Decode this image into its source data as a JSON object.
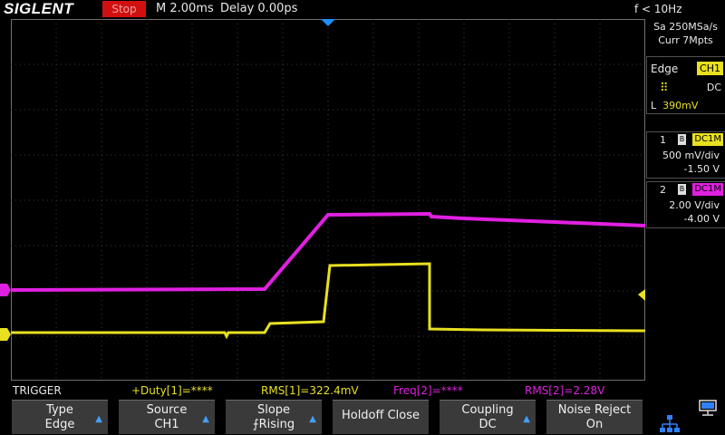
{
  "topbar": {
    "brand": "SIGLENT",
    "run_status": "Stop",
    "timebase": "M 2.00ms",
    "delay": "Delay 0.00ps",
    "frequency": "f < 10Hz"
  },
  "acquisition": {
    "sample_rate": "Sa 250MSa/s",
    "memory": "Curr 7Mpts"
  },
  "trigger_panel": {
    "type": "Edge",
    "source": "CH1",
    "coupling": "DC",
    "level_label": "L",
    "level": "390mV"
  },
  "channels": [
    {
      "number": "1",
      "coupling": "DC1M",
      "vdiv": "500 mV/div",
      "offset": "-1.50 V",
      "color": "#e8e020"
    },
    {
      "number": "2",
      "coupling": "DC1M",
      "vdiv": "2.00 V/div",
      "offset": "-4.00 V",
      "color": "#e020e0"
    }
  ],
  "measurements": {
    "menu_title": "TRIGGER",
    "duty1": "+Duty[1]=****",
    "rms1": "RMS[1]=322.4mV",
    "freq2": "Freq[2]=****",
    "rms2": "RMS[2]=2.28V"
  },
  "softkeys": [
    {
      "line1": "Type",
      "line2": "Edge"
    },
    {
      "line1": "Source",
      "line2": "CH1"
    },
    {
      "line1": "Slope",
      "line2": "Rising"
    },
    {
      "line1": "Holdoff Close",
      "line2": ""
    },
    {
      "line1": "Coupling",
      "line2": "DC"
    },
    {
      "line1": "Noise Reject",
      "line2": "On"
    }
  ],
  "colors": {
    "ch1": "#e8e020",
    "ch2": "#e020e0",
    "trigger_marker": "#1e90ff",
    "stop_badge": "#d01010"
  },
  "icons": [
    "network-icon",
    "usb-icon",
    "rising-edge-icon",
    "trigger-position-icon"
  ]
}
